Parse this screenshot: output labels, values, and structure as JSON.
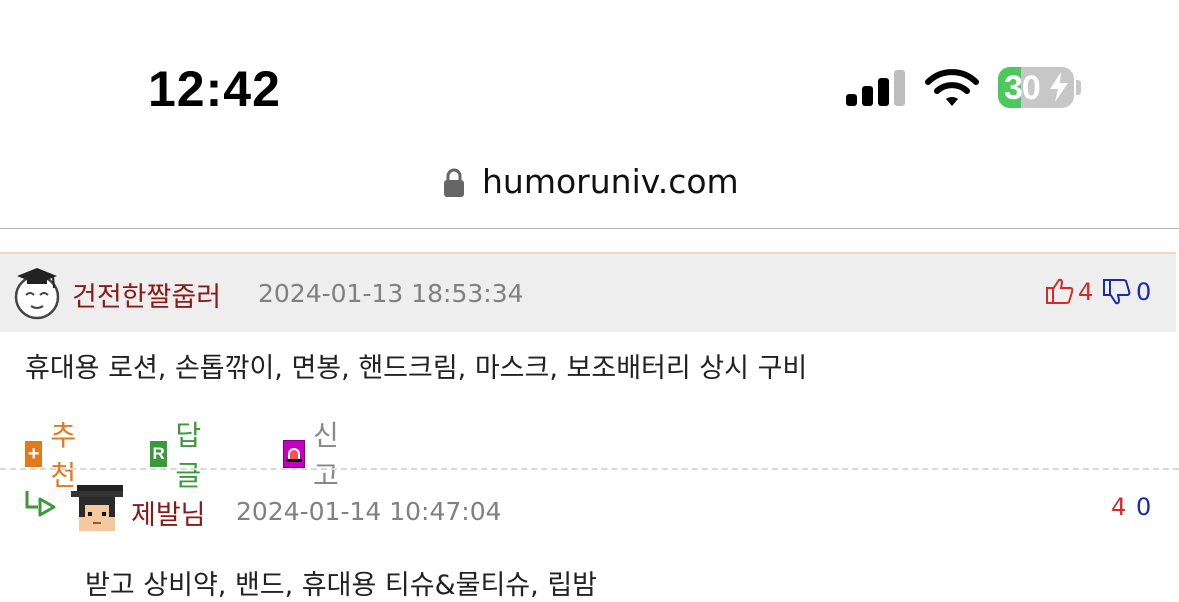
{
  "status_bar": {
    "time": "12:42",
    "battery_percent": "30",
    "icons": [
      "cellular-signal-icon",
      "wifi-icon",
      "battery-charging-icon"
    ]
  },
  "browser": {
    "url": "humoruniv.com"
  },
  "comments": [
    {
      "author": "건전한짤줍러",
      "date": "2024-01-13 18:53:34",
      "up": "4",
      "down": "0",
      "text": "휴대용 로션, 손톱깎이, 면봉, 핸드크림, 마스크, 보조배터리 상시 구비",
      "actions": {
        "recommend": "추천",
        "reply": "답글",
        "report": "신고"
      }
    },
    {
      "author": "제발님",
      "date": "2024-01-14 10:47:04",
      "up": "4",
      "down": "0",
      "text": "받고 상비약, 밴드, 휴대용 티슈&물티슈, 립밤"
    }
  ],
  "colors": {
    "author": "#8a1a1a",
    "up": "#d42a2a",
    "down": "#1a2aa8",
    "recommend": "#e07a1f",
    "reply": "#3a9a3a",
    "report": "#c400c4"
  }
}
